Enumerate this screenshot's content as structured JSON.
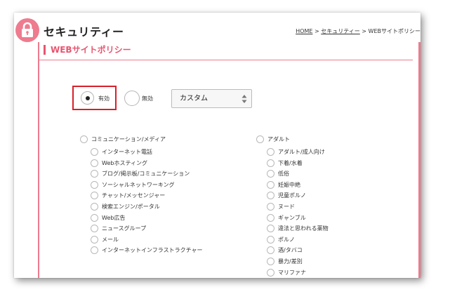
{
  "header": {
    "title": "セキュリティー",
    "breadcrumb": {
      "home": "HOME",
      "sep1": " > ",
      "security": "セキュリティー",
      "sep2": " > ",
      "current": "WEBサイトポリシー"
    }
  },
  "section": {
    "title": "WEBサイトポリシー"
  },
  "policy_toggle": {
    "enabled_label": "有効",
    "disabled_label": "無効",
    "selected": "有効"
  },
  "mode_select": {
    "value": "カスタム"
  },
  "categories": {
    "communication": {
      "label": "コミュニケーション/メディア",
      "items": [
        "インターネット電話",
        "Webホスティング",
        "ブログ/掲示板/コミュニケーション",
        "ソーシャルネットワーキング",
        "チャット/メッセンジャー",
        "検索エンジン/ポータル",
        "Web広告",
        "ニュースグループ",
        "メール",
        "インターネットインフラストラクチャー"
      ]
    },
    "adult": {
      "label": "アダルト",
      "items": [
        "アダルト/成人向け",
        "下着/水着",
        "低俗",
        "妊娠中絶",
        "児童ポルノ",
        "ヌード",
        "ギャンブル",
        "違法と思われる薬物",
        "ポルノ",
        "酒/タバコ",
        "暴力/差別",
        "マリファナ"
      ]
    }
  },
  "colors": {
    "accent": "#e8556f",
    "highlight": "#d8202a"
  }
}
